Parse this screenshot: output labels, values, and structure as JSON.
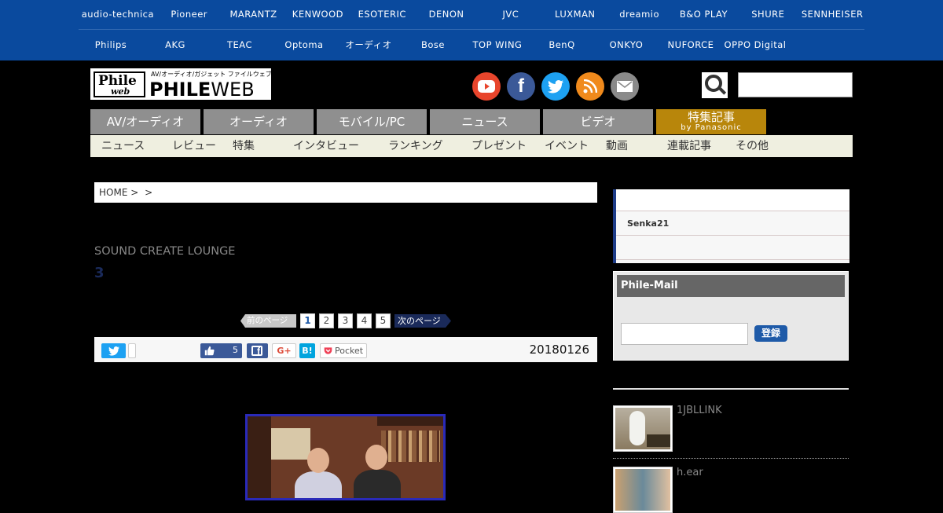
{
  "brands": {
    "row1": [
      "audio-technica",
      "Pioneer",
      "MARANTZ",
      "KENWOOD",
      "ESOTERIC",
      "DENON",
      "JVC",
      "LUXMAN",
      "dreamio",
      "B&O PLAY",
      "SHURE",
      "SENNHEISER"
    ],
    "row2": [
      "Philips",
      "AKG",
      "TEAC",
      "Optoma",
      "オーディオ",
      "Bose",
      "TOP WING",
      "BenQ",
      "ONKYO",
      "NUFORCE",
      "OPPO Digital"
    ]
  },
  "logo": {
    "name": "Phile",
    "sub": "web",
    "tagline": "AV/オーディオ/ガジェット ファイルウェブ",
    "word_bold": "PHILE",
    "word_light": "WEB"
  },
  "social": [
    "youtube-icon",
    "facebook-icon",
    "twitter-icon",
    "rss-icon",
    "mail-icon"
  ],
  "search": {
    "placeholder": ""
  },
  "nav_main": [
    {
      "label": "AV/オーディオ"
    },
    {
      "label": "オーディオ"
    },
    {
      "label": "モバイル/PC"
    },
    {
      "label": "ニュース"
    },
    {
      "label": "ビデオ"
    },
    {
      "label": "特集記事",
      "sub": "by Panasonic"
    }
  ],
  "nav_sub": [
    "ニュース",
    "レビュー",
    "特集",
    "インタビュー",
    "ランキング",
    "プレゼント",
    "イベント",
    "動画",
    "連載記事",
    "その他"
  ],
  "breadcrumb": {
    "home": "HOME",
    "sep1": ">",
    "sep2": ">"
  },
  "article": {
    "series": "SOUND CREATE LOUNGE",
    "subtitle": "3",
    "date": "20180126"
  },
  "pager": {
    "prev": "前のページ",
    "pages": [
      "1",
      "2",
      "3",
      "4",
      "5"
    ],
    "current": "1",
    "next": "次のページ"
  },
  "share": {
    "like_count": "5",
    "gplus": "G+",
    "hatena": "B!",
    "pocket": "Pocket"
  },
  "sidebar": {
    "list": [
      "",
      "Senka21",
      ""
    ],
    "mail_title": "Phile-Mail",
    "mail_button": "登録",
    "news": [
      {
        "title": "1JBLLINK"
      },
      {
        "title": "h.ear"
      }
    ]
  },
  "colors": {
    "topbar": "#0a4a9e",
    "nav_tab": "#8f8f8f",
    "nav_gold": "#b8860b",
    "accent": "#1e5aa8"
  }
}
